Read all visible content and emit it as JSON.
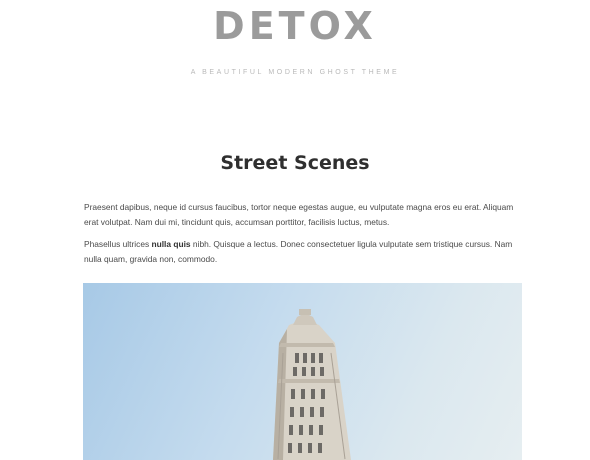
{
  "header": {
    "logo_text": "DETOX",
    "tagline": "A BEAUTIFUL MODERN GHOST THEME"
  },
  "post": {
    "title": "Street Scenes",
    "paragraph_1": "Praesent dapibus, neque id cursus faucibus, tortor neque egestas augue, eu vulputate magna eros eu erat. Aliquam erat volutpat. Nam dui mi, tincidunt quis, accumsan porttitor, facilisis luctus, metus.",
    "paragraph_2_before": "Phasellus ultrices ",
    "paragraph_2_bold": "nulla quis",
    "paragraph_2_after": " nibh. Quisque a lectus. Donec consectetuer ligula vulputate sem tristique cursus. Nam nulla quam, gravida non, commodo."
  },
  "colors": {
    "logo": "#9b9b9b",
    "title": "#2f2f2f",
    "body_text": "#4a4a4a",
    "sky": "#c4dbee"
  }
}
